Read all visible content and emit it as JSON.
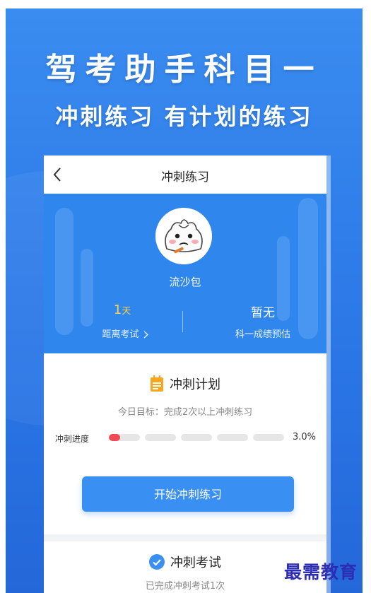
{
  "poster": {
    "headline": "驾考助手科目一",
    "subheadline": "冲刺练习 有计划的练习"
  },
  "nav": {
    "title": "冲刺练习"
  },
  "profile": {
    "username": "流沙包",
    "days_left_value": "1",
    "days_left_unit": "天",
    "days_left_label": "距离考试",
    "score_value": "暂无",
    "score_label": "科一成绩预估"
  },
  "plan": {
    "title": "冲刺计划",
    "goal": "今日目标：完成2次以上冲刺练习",
    "progress_label": "冲刺进度",
    "progress_percent": "3.0%",
    "progress_fraction": 0.03,
    "start_button": "开始冲刺练习"
  },
  "exam": {
    "title": "冲刺考试",
    "status": "已完成冲刺考试1次"
  },
  "watermark": "最需教育",
  "colors": {
    "primary_blue": "#2f87ee",
    "accent_yellow": "#ffd14a",
    "progress_red": "#f04b55",
    "plan_icon_orange": "#f5a623"
  }
}
